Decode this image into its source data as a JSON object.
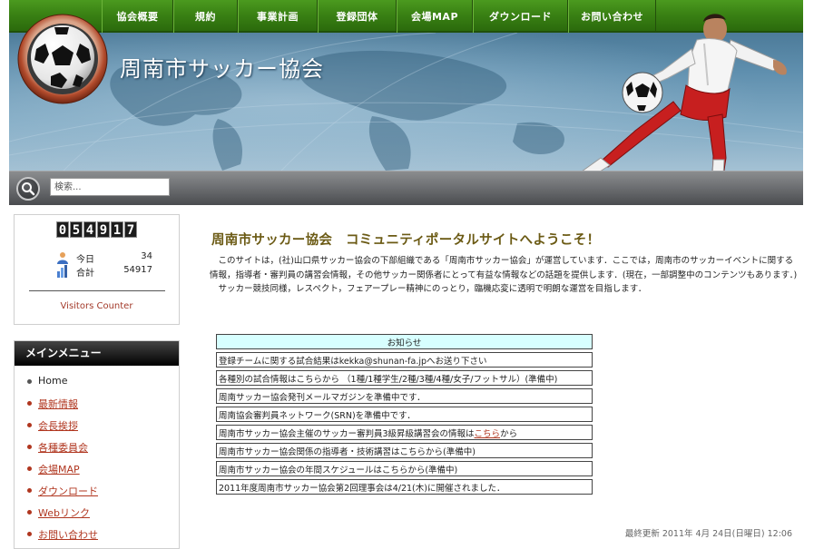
{
  "nav": {
    "items": [
      "協会概要",
      "規約",
      "事業計画",
      "登録団体",
      "会場MAP",
      "ダウンロード",
      "お問い合わせ"
    ]
  },
  "header": {
    "site_title": "周南市サッカー協会"
  },
  "search": {
    "placeholder": "検索..."
  },
  "counter": {
    "digits": [
      "0",
      "5",
      "4",
      "9",
      "1",
      "7"
    ],
    "today_label": "今日",
    "today_value": "34",
    "total_label": "合計",
    "total_value": "54917",
    "caption": "Visitors Counter"
  },
  "menu": {
    "title": "メインメニュー",
    "items": [
      "Home",
      "最新情報",
      "会長挨拶",
      "各種委員会",
      "会場MAP",
      "ダウンロード",
      "Webリンク",
      "お問い合わせ"
    ]
  },
  "main": {
    "title": "周南市サッカー協会　コミュニティポータルサイトへようこそ！",
    "intro_1": "　このサイトは，(社)山口県サッカー協会の下部組織である「周南市サッカー協会」が運営しています．ここでは，周南市のサッカーイベントに関する情報，指導者・審判員の講習会情報，その他サッカー関係者にとって有益な情報などの話題を提供します．(現在，一部調整中のコンテンツもあります．)",
    "intro_2": "　サッカー競技同様，レスペクト，フェアープレー精神にのっとり，臨機応変に透明で明朗な運営を目指します．"
  },
  "notices": {
    "header": "お知らせ",
    "rows": [
      "登録チームに関する試合結果はkekka@shunan-fa.jpへお送り下さい",
      "各種別の試合情報はこちらから （1種/1種学生/2種/3種/4種/女子/フットサル）(準備中)",
      "周南サッカー協会発刊メールマガジンを準備中です．",
      "周南協会審判員ネットワーク(SRN)を準備中です．",
      "周南市サッカー協会主催のサッカー審判員3級昇級講習会の情報は",
      "周南市サッカー協会関係の指導者・技術講習はこちらから(準備中)",
      "周南市サッカー協会の年間スケジュールはこちらから(準備中)",
      "2011年度周南市サッカー協会第2回理事会は4/21(木)に開催されました．"
    ],
    "link_text": "こちら",
    "link_suffix": "から"
  },
  "footer": {
    "updated": "最終更新 2011年 4月 24日(日曜日) 12:06"
  },
  "colors": {
    "nav_green": "#3a8214",
    "title_olive": "#6b5a14",
    "link_red": "#b0361f",
    "notice_header_bg": "#d7ffff"
  }
}
